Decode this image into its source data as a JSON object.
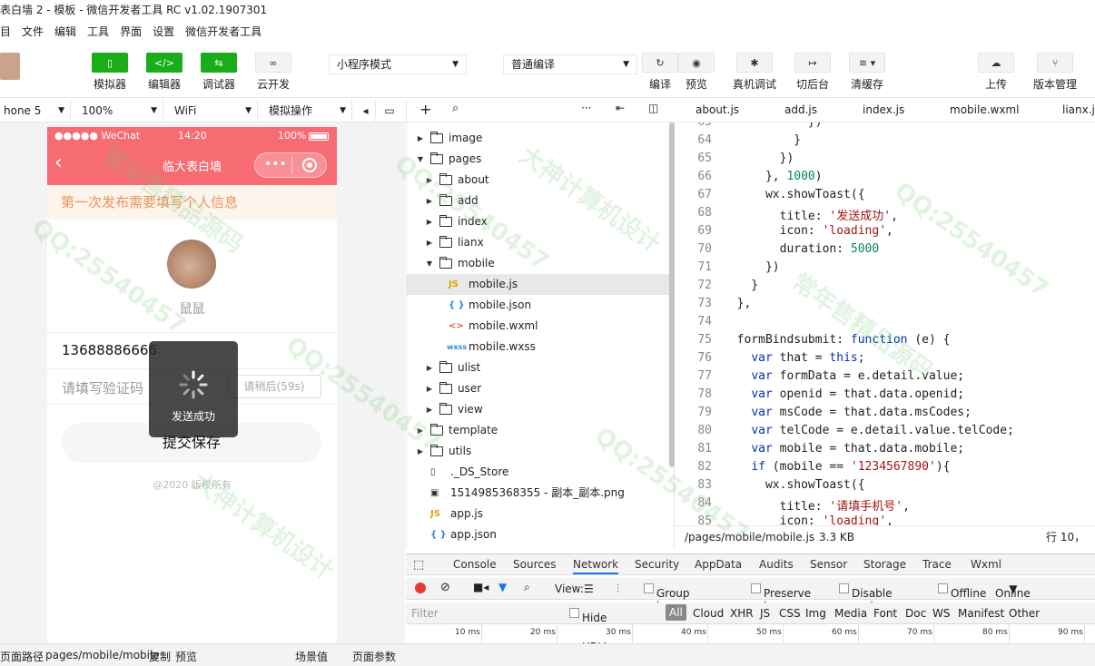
{
  "window": {
    "title": "表白墙 2 - 模板 - 微信开发者工具 RC v1.02.1907301"
  },
  "menu": [
    "目",
    "文件",
    "编辑",
    "工具",
    "界面",
    "设置",
    "微信开发者工具"
  ],
  "toolbar": {
    "simulator": "模拟器",
    "editor": "编辑器",
    "debugger": "调试器",
    "cloud": "云开发",
    "mode": "小程序模式",
    "compile_mode": "普通编译",
    "compile": "编译",
    "preview": "预览",
    "remote_debug": "真机调试",
    "background": "切后台",
    "clear_cache": "清缓存",
    "upload": "上传",
    "version": "版本管理"
  },
  "simbar": {
    "device": "hone 5",
    "zoom": "100%",
    "network": "WiFi",
    "ops": "模拟操作"
  },
  "phone": {
    "status_left": "●●●●● WeChat",
    "status_time": "14:20",
    "status_battery": "100%",
    "nav_title": "临大表白墙",
    "notice": "第一次发布需要填写个人信息",
    "username": "鼠鼠",
    "phone_number": "13688886666",
    "code_placeholder": "请填写验证码",
    "code_button": "请稍后(59s)",
    "submit": "提交保存",
    "copyright": "@2020 版权所有",
    "toast": "发送成功"
  },
  "tree": {
    "items": [
      {
        "name": "image",
        "type": "folder",
        "level": 0,
        "expanded": false
      },
      {
        "name": "pages",
        "type": "folder",
        "level": 0,
        "expanded": true
      },
      {
        "name": "about",
        "type": "folder",
        "level": 1,
        "expanded": false
      },
      {
        "name": "add",
        "type": "folder",
        "level": 1,
        "expanded": false
      },
      {
        "name": "index",
        "type": "folder",
        "level": 1,
        "expanded": false
      },
      {
        "name": "lianx",
        "type": "folder",
        "level": 1,
        "expanded": false
      },
      {
        "name": "mobile",
        "type": "folder",
        "level": 1,
        "expanded": true
      },
      {
        "name": "mobile.js",
        "type": "js",
        "level": 2
      },
      {
        "name": "mobile.json",
        "type": "json",
        "level": 2
      },
      {
        "name": "mobile.wxml",
        "type": "wxml",
        "level": 2
      },
      {
        "name": "mobile.wxss",
        "type": "wxss",
        "level": 2
      },
      {
        "name": "ulist",
        "type": "folder",
        "level": 1,
        "expanded": false
      },
      {
        "name": "user",
        "type": "folder",
        "level": 1,
        "expanded": false
      },
      {
        "name": "view",
        "type": "folder",
        "level": 1,
        "expanded": false
      },
      {
        "name": "template",
        "type": "folder",
        "level": 0,
        "expanded": false
      },
      {
        "name": "utils",
        "type": "folder",
        "level": 0,
        "expanded": false
      },
      {
        "name": "._DS_Store",
        "type": "file",
        "level": 0
      },
      {
        "name": "1514985368355 - 副本_副本.png",
        "type": "image",
        "level": 0
      },
      {
        "name": "app.js",
        "type": "js",
        "level": 0
      },
      {
        "name": "app.json",
        "type": "json",
        "level": 0
      }
    ]
  },
  "editor": {
    "tabs": [
      "about.js",
      "add.js",
      "index.js",
      "mobile.wxml",
      "lianx.js"
    ],
    "lines": [
      {
        "no": "65",
        "code": "            })"
      },
      {
        "no": "64",
        "code": "          }"
      },
      {
        "no": "65",
        "code": "        })"
      },
      {
        "no": "66",
        "code": "      }, 1000)"
      },
      {
        "no": "67",
        "code": "      wx.showToast({"
      },
      {
        "no": "68",
        "code": "        title: '发送成功',"
      },
      {
        "no": "69",
        "code": "        icon: 'loading',"
      },
      {
        "no": "70",
        "code": "        duration: 5000"
      },
      {
        "no": "71",
        "code": "      })"
      },
      {
        "no": "72",
        "code": "    }"
      },
      {
        "no": "73",
        "code": "  },"
      },
      {
        "no": "74",
        "code": ""
      },
      {
        "no": "75",
        "code": "  formBindsubmit: function (e) {"
      },
      {
        "no": "76",
        "code": "    var that = this;"
      },
      {
        "no": "77",
        "code": "    var formData = e.detail.value;"
      },
      {
        "no": "78",
        "code": "    var openid = that.data.openid;"
      },
      {
        "no": "79",
        "code": "    var msCode = that.data.msCodes;"
      },
      {
        "no": "80",
        "code": "    var telCode = e.detail.value.telCode;"
      },
      {
        "no": "81",
        "code": "    var mobile = that.data.mobile;"
      },
      {
        "no": "82",
        "code": "    if (mobile == '1234567890'){"
      },
      {
        "no": "83",
        "code": "      wx.showToast({"
      },
      {
        "no": "84",
        "code": "        title: '请填手机号',"
      },
      {
        "no": "85",
        "code": "        icon: 'loading',"
      }
    ],
    "status_path": "/pages/mobile/mobile.js",
    "status_size": "3.3 KB",
    "status_pos": "行 10，列"
  },
  "devtools": {
    "tabs": [
      "Console",
      "Sources",
      "Network",
      "Security",
      "AppData",
      "Audits",
      "Sensor",
      "Storage",
      "Trace",
      "Wxml"
    ],
    "active_tab": "Network",
    "view_label": "View:",
    "group_by_frame": "Group by frame",
    "preserve_log": "Preserve log",
    "disable_cache": "Disable cache",
    "offline": "Offline",
    "online": "Online",
    "filter_placeholder": "Filter",
    "hide_data_urls": "Hide data URLs",
    "filters": [
      "All",
      "Cloud",
      "XHR",
      "JS",
      "CSS",
      "Img",
      "Media",
      "Font",
      "Doc",
      "WS",
      "Manifest",
      "Other"
    ],
    "timeline": [
      "10 ms",
      "20 ms",
      "30 ms",
      "40 ms",
      "50 ms",
      "60 ms",
      "70 ms",
      "80 ms",
      "90 ms"
    ]
  },
  "bottom": {
    "path_label": "页面路径",
    "path": "pages/mobile/mobile",
    "copy": "复制",
    "preview": "预览",
    "scene": "场景值",
    "params": "页面参数"
  },
  "watermark": {
    "qq": "QQ:25540457",
    "slogan_a": "大神计算机设计",
    "slogan_b": "常年售精品源码"
  }
}
